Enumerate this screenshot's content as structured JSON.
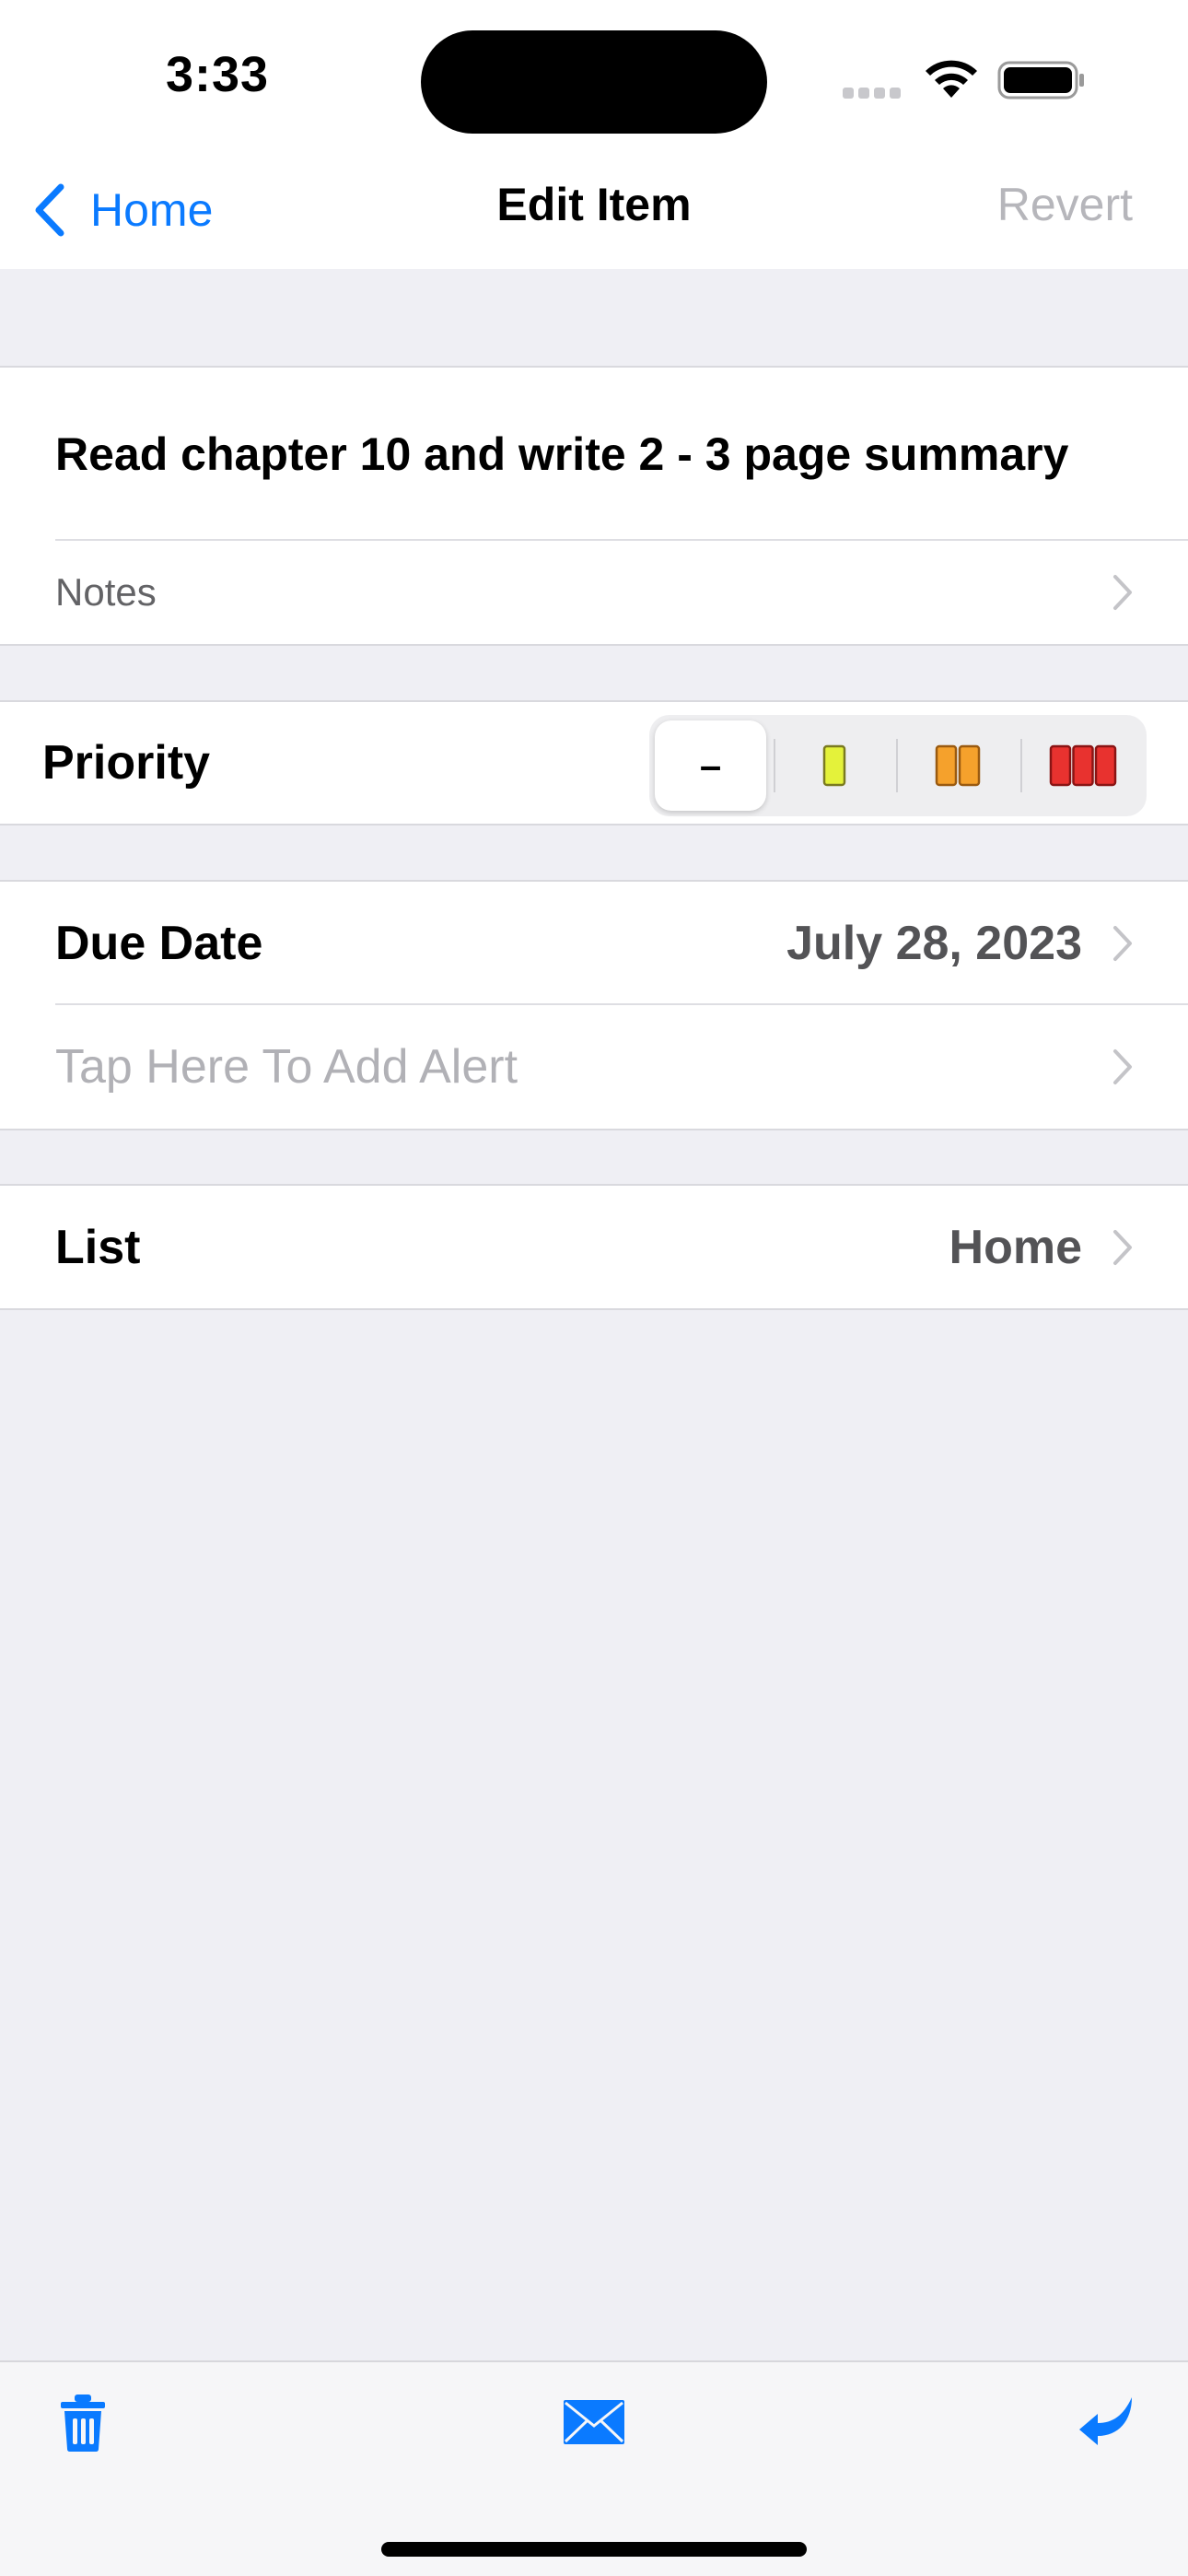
{
  "status_bar": {
    "time": "3:33"
  },
  "nav": {
    "back_label": "Home",
    "title": "Edit Item",
    "revert_label": "Revert"
  },
  "item": {
    "title": "Read chapter 10 and write 2 - 3 page summary",
    "notes_label": "Notes"
  },
  "priority": {
    "label": "Priority",
    "options": [
      "none",
      "low",
      "medium",
      "high"
    ],
    "selected": "none",
    "none_symbol": "–"
  },
  "due": {
    "label": "Due Date",
    "value": "July 28, 2023",
    "alert_placeholder": "Tap Here To Add Alert"
  },
  "list": {
    "label": "List",
    "value": "Home"
  },
  "toolbar": {
    "icons": [
      "trash-icon",
      "mail-icon",
      "return-arrow-icon"
    ]
  },
  "colors": {
    "accent": "#0a7aff",
    "priority_low": "#e4f23a",
    "priority_medium": "#f5a12c",
    "priority_high": "#e8322f",
    "background": "#efeff4"
  }
}
